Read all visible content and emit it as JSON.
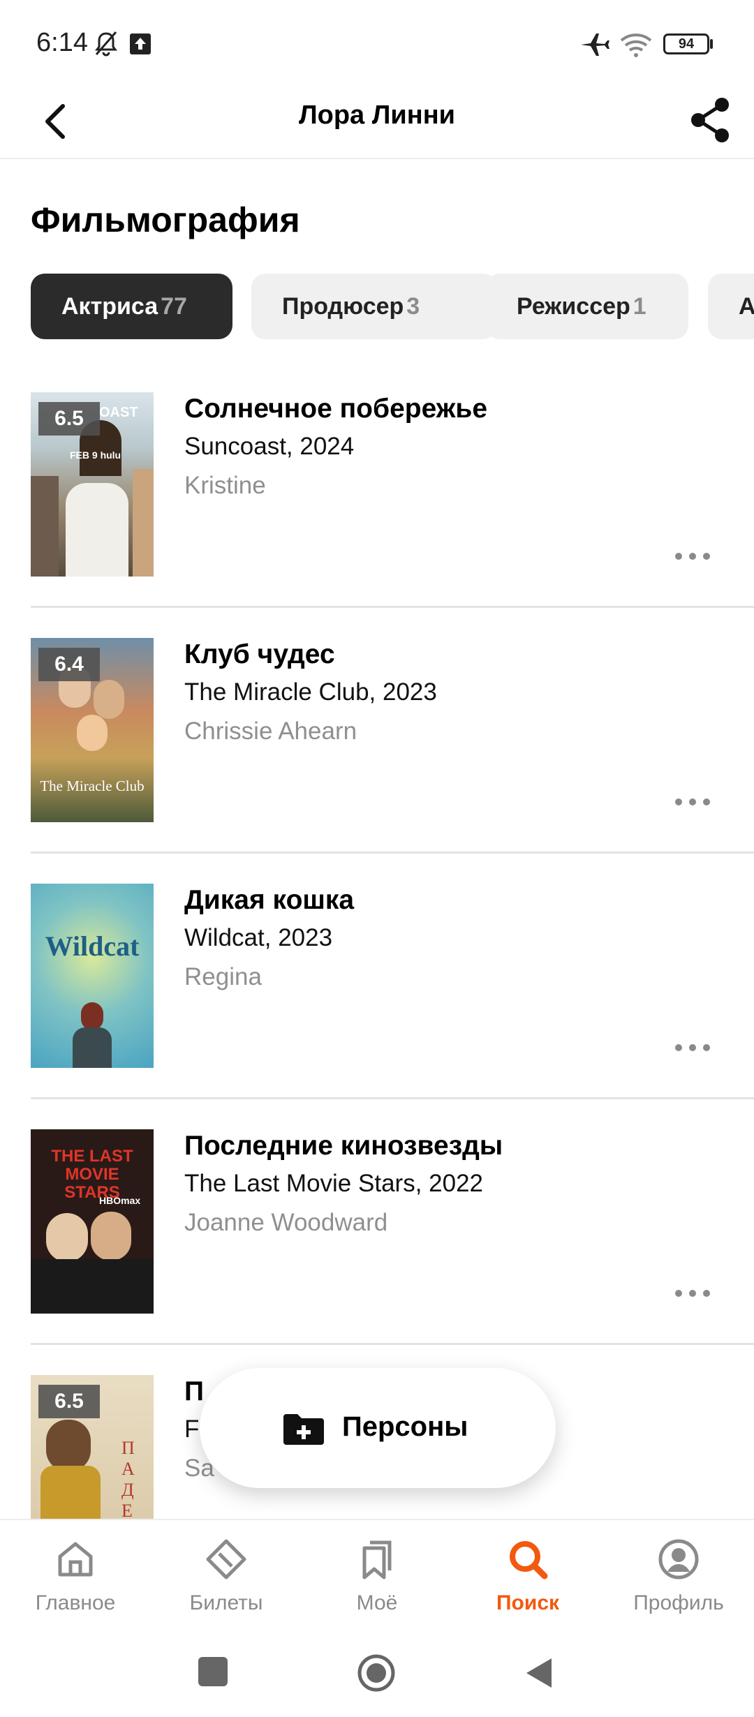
{
  "status_bar": {
    "time": "6:14",
    "battery": "94",
    "icons": [
      "bell-off-icon",
      "upload-icon",
      "airplane-icon",
      "wifi-icon",
      "battery-icon"
    ]
  },
  "header": {
    "title": "Лора Линни",
    "back_icon": "chevron-left-icon",
    "share_icon": "share-icon"
  },
  "section_title": "Фильмография",
  "chips": [
    {
      "label": "Актриса",
      "count": "77",
      "active": true
    },
    {
      "label": "Продюсер",
      "count": "3",
      "active": false
    },
    {
      "label": "Режиссер",
      "count": "1",
      "active": false
    },
    {
      "label": "А",
      "count": "",
      "active": false
    }
  ],
  "films": [
    {
      "title": "Солнечное побережье",
      "original": "Suncoast, 2024",
      "role": "Kristine",
      "rating": "6.5",
      "poster_text": "OAST",
      "poster_sub": "FEB 9  hulu"
    },
    {
      "title": "Клуб чудес",
      "original": "The Miracle Club, 2023",
      "role": "Chrissie Ahearn",
      "rating": "6.4",
      "poster_text": "The Miracle Club",
      "poster_sub": ""
    },
    {
      "title": "Дикая кошка",
      "original": "Wildcat, 2023",
      "role": "Regina",
      "rating": "",
      "poster_text": "Wildcat",
      "poster_sub": ""
    },
    {
      "title": "Последние кинозвезды",
      "original": "The Last Movie Stars, 2022",
      "role": "Joanne Woodward",
      "rating": "",
      "poster_text": "THE LAST MOVIE STARS",
      "poster_sub": "HBOmax"
    },
    {
      "title": "П",
      "original": "F",
      "role": "Sa",
      "rating": "6.5",
      "poster_text": "ПАДЕН",
      "poster_sub": ""
    }
  ],
  "fab": {
    "label": "Персоны",
    "icon": "folder-plus-icon"
  },
  "bottom_nav": [
    {
      "label": "Главное",
      "icon": "home-icon",
      "active": false
    },
    {
      "label": "Билеты",
      "icon": "ticket-icon",
      "active": false
    },
    {
      "label": "Моё",
      "icon": "bookmarks-icon",
      "active": false
    },
    {
      "label": "Поиск",
      "icon": "search-icon",
      "active": true
    },
    {
      "label": "Профиль",
      "icon": "profile-icon",
      "active": false
    }
  ],
  "colors": {
    "accent": "#f25a0f",
    "chip_active": "#2b2b2b",
    "chip_inactive": "#f0f0f0",
    "secondary_text": "#8f8f8f"
  }
}
